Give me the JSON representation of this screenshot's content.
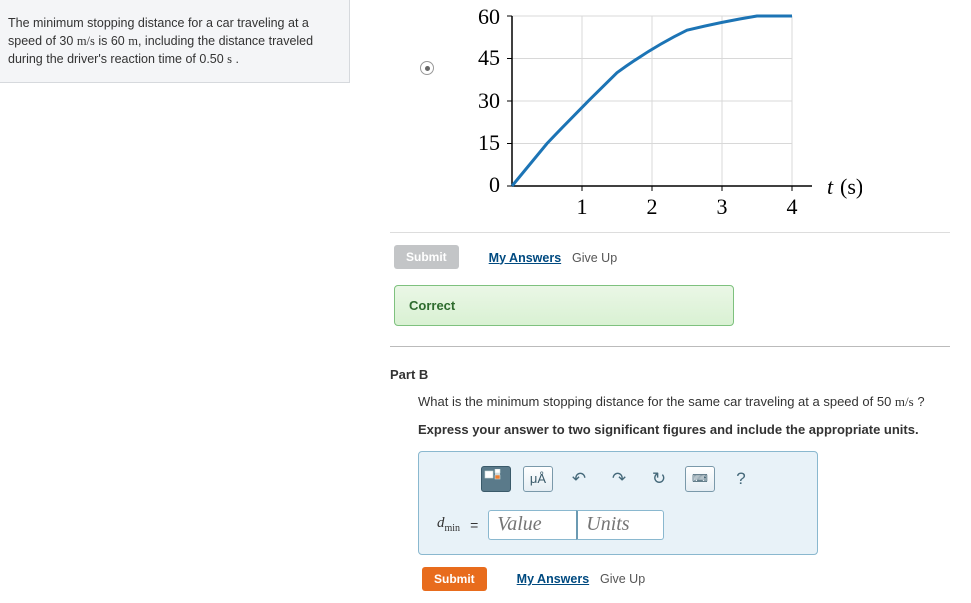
{
  "problem": {
    "text_before": "The minimum stopping distance for a car traveling at a speed of 30 ",
    "unit1": "m/s",
    "text_mid1": " is 60 ",
    "unit2": "m",
    "text_mid2": ", including the distance traveled during the driver's reaction time of 0.50 ",
    "unit3": "s",
    "text_end": " ."
  },
  "chart_data": {
    "type": "line",
    "x": [
      0,
      0.5,
      1,
      1.5,
      2,
      2.5,
      3,
      3.5,
      4
    ],
    "y": [
      0,
      15,
      28,
      40,
      49,
      55,
      58,
      60,
      60
    ],
    "xlabel": "t (s)",
    "ylabel": "",
    "xlim": [
      0,
      4
    ],
    "ylim": [
      0,
      60
    ],
    "xticks": [
      1,
      2,
      3,
      4
    ],
    "yticks": [
      0,
      15,
      30,
      45,
      60
    ]
  },
  "partA": {
    "submit_label": "Submit",
    "my_answers": "My Answers",
    "give_up": "Give Up",
    "feedback": "Correct"
  },
  "partB": {
    "label": "Part B",
    "question_before": "What is the minimum stopping distance for the same car traveling at a speed of 50  ",
    "question_unit": "m/s",
    "question_after": " ?",
    "instruction": "Express your answer to two significant figures and include the appropriate units.",
    "toolbar": {
      "units_label": "μÅ",
      "help": "?"
    },
    "var_d": "d",
    "var_sub": "min",
    "equals": "=",
    "value_placeholder": "Value",
    "units_placeholder": "Units",
    "submit_label": "Submit",
    "my_answers": "My Answers",
    "give_up": "Give Up"
  }
}
